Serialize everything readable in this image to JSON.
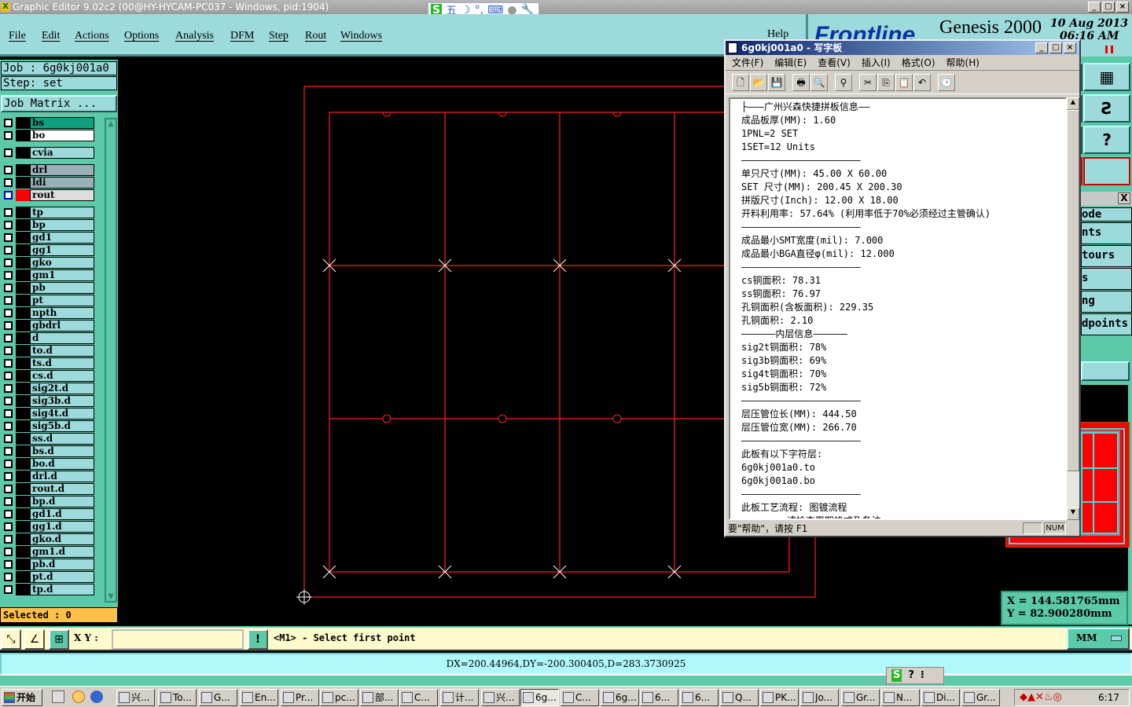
{
  "app": {
    "title": "Graphic Editor 9.02c2 (00@HY-HYCAM-PC037 - Windows, pid:1904)",
    "ime_icons": [
      "sogou-s",
      "wu",
      "moon",
      "punct",
      "keyboard",
      "user",
      "wrench"
    ],
    "ime_wu": "五"
  },
  "menu": [
    "File",
    "Edit",
    "Actions",
    "Options",
    "Analysis",
    "DFM",
    "Step",
    "Rout",
    "Windows"
  ],
  "help": "Help",
  "logo": {
    "brand": "Frontline",
    "product": "Genesis 2000",
    "date": "10 Aug 2013",
    "time": "06:16 AM"
  },
  "job": {
    "job_label": "Job : 6g0kj001a0",
    "step_label": "Step: set",
    "matrix_button": "Job Matrix ..."
  },
  "layers": [
    "bs",
    "bo",
    "cvia",
    "drl",
    "ldi",
    "rout",
    "tp",
    "bp",
    "gd1",
    "gg1",
    "gko",
    "gm1",
    "pb",
    "pt",
    "npth",
    "gbdrl",
    "d",
    "to.d",
    "ts.d",
    "cs.d",
    "sig2t.d",
    "sig3b.d",
    "sig4t.d",
    "sig5b.d",
    "ss.d",
    "bs.d",
    "bo.d",
    "drl.d",
    "rout.d",
    "bp.d",
    "gd1.d",
    "gg1.d",
    "gko.d",
    "gm1.d",
    "pb.d",
    "pt.d",
    "tp.d"
  ],
  "active_layer": "rout",
  "colors": {
    "canvas": "#000000",
    "profile": "#ff2020",
    "panel": "#9ddadb",
    "accent": "#5ccaa8",
    "selected_bar": "#ffc04a"
  },
  "selected": "Selected : 0",
  "cmd": {
    "xy_label": "X Y :",
    "xy_value": "",
    "prompt": "<M1> - Select first point",
    "units": "MM"
  },
  "measure": "DX=200.44964,DY=-200.300405,D=283.3730925",
  "coords": {
    "x": "X = 144.581765mm",
    "y": "Y = 82.900280mm"
  },
  "right_panel": {
    "items": [
      "ode",
      "nts",
      "tours",
      "s",
      "ng",
      "dpoints"
    ],
    "close": "X"
  },
  "notepad": {
    "title": "6g0kj001a0 - 写字板",
    "menu": [
      "文件(F)",
      "编辑(E)",
      "查看(V)",
      "插入(I)",
      "格式(O)",
      "帮助(H)"
    ],
    "lines": [
      "├———广州兴森快捷拼板信息——",
      "成品板厚(MM): 1.60",
      "1PNL=2 SET",
      "1SET=12 Units",
      "—————————————————————",
      "单只尺寸(MM): 45.00 X 60.00",
      "SET 尺寸(MM): 200.45 X 200.30",
      "拼版尺寸(Inch): 12.00 X 18.00",
      "开料利用率: 57.64% (利用率低于70%必须经过主管确认)",
      "—————————————————————",
      "成品最小SMT宽度(mil): 7.000",
      "成品最小BGA直径φ(mil): 12.000",
      "—————————————————————",
      "cs铜面积: 78.31",
      "ss铜面积: 76.97",
      "孔铜面积(含板面积): 229.35",
      "孔铜面积: 2.10",
      "——————内层信息——————",
      "sig2t铜面积: 78%",
      "sig3b铜面积: 69%",
      "sig4t铜面积: 70%",
      "sig5b铜面积: 72%",
      "—————————————————————",
      "层压管位长(MM): 444.50",
      "层压管位宽(MM): 266.70",
      "—————————————————————",
      "此板有以下字符层:",
      "6g0kj001a0.to",
      "6g0kj001a0.bo",
      "—————————————————————",
      "此板工艺流程: 图镀流程",
      "<<<<<<< 请检查周期格式及备注 >>>>>>>>"
    ],
    "status": "要\"帮助\"，请按 F1",
    "num": "NUM"
  },
  "taskbar": {
    "start": "开始",
    "tasks": [
      "兴...",
      "To...",
      "G...",
      "En...",
      "Pr...",
      "pc...",
      "部...",
      "C...",
      "计...",
      "兴...",
      "6g...",
      "C...",
      "6g...",
      "6...",
      "6...",
      "Q...",
      "PK...",
      "Jo...",
      "Gr...",
      "N...",
      "Di...",
      "Gr..."
    ],
    "clock": "6:17"
  }
}
